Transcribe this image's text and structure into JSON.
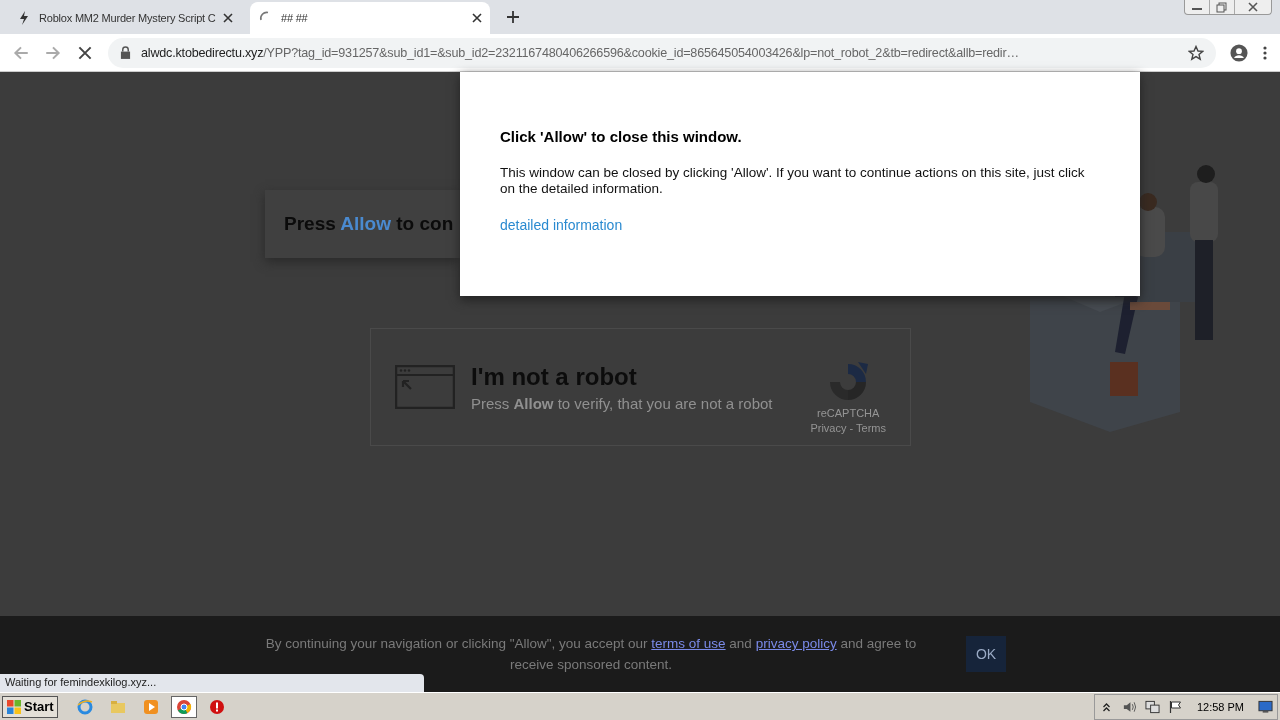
{
  "browser": {
    "tabs": [
      {
        "title": "Roblox MM2 Murder Mystery Script C",
        "selected": false,
        "loading": false
      },
      {
        "title": "## ##",
        "selected": true,
        "loading": true
      }
    ],
    "address": {
      "host": "alwdc.ktobedirectu.xyz",
      "path": "/YPP?tag_id=931257&sub_id1=&sub_id2=2321167480406266596&cookie_id=865645054003426&lp=not_robot_2&tb=redirect&allb=redir…"
    },
    "loading": true
  },
  "page": {
    "press_card": {
      "before": "Press",
      "highlight": "Allow",
      "after": "to con"
    },
    "captcha": {
      "title": "I'm not a robot",
      "subtitle": "Press **Allow** to verify, that you are not a robot",
      "brand": "reCAPTCHA",
      "links": "Privacy - Terms"
    },
    "banner": {
      "before": "By continuing your navigation or clicking \"Allow\", you accept our",
      "terms": "terms of use",
      "middle": "and",
      "privacy": "privacy policy",
      "after": "and agree to receive sponsored content.",
      "button": "OK"
    },
    "status": "Waiting for femindexkilog.xyz..."
  },
  "popup": {
    "title": "Click 'Allow' to close this window.",
    "body": "This window can be closed by clicking 'Allow'. If you want to continue actions on this site, just click on the detailed information.",
    "link": "detailed information"
  },
  "taskbar": {
    "start": "Start",
    "apps": [
      {
        "kind": "ie",
        "selected": false
      },
      {
        "kind": "folder",
        "selected": false
      },
      {
        "kind": "media",
        "selected": false
      },
      {
        "kind": "chrome",
        "selected": true
      },
      {
        "kind": "stop",
        "selected": false
      }
    ],
    "clock": "12:58 PM"
  }
}
